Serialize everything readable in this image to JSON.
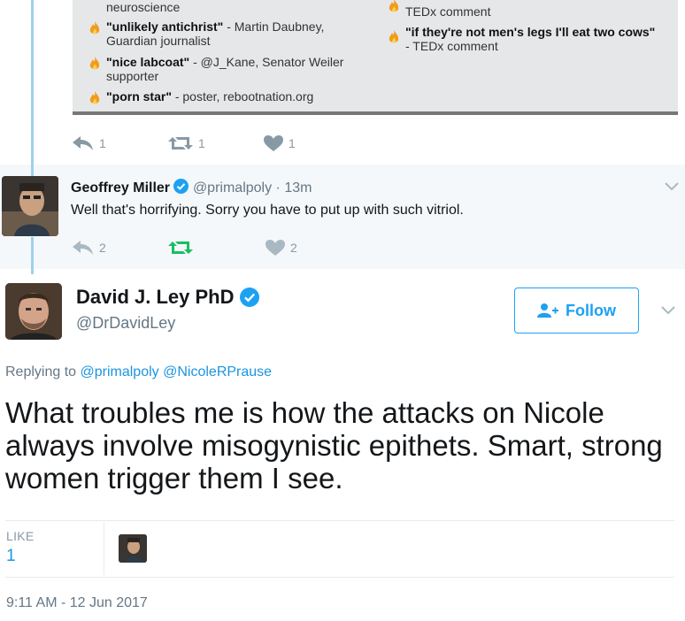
{
  "quoted_card": {
    "left_items": [
      {
        "tail": "neuroscience"
      },
      {
        "quote": "\"unlikely antichrist\"",
        "source": " - Martin Daubney, Guardian journalist"
      },
      {
        "quote": "\"nice labcoat\"",
        "source": " -  @J_Kane, Senator Weiler supporter"
      },
      {
        "quote": "\"porn star\"",
        "source": " - poster, rebootnation.org"
      }
    ],
    "right_items": [
      {
        "source": "TEDx comment"
      },
      {
        "quote": "\"if they're not men's legs I'll eat two cows\"",
        "source": " - TEDx comment"
      }
    ],
    "actions": {
      "replies": "1",
      "retweets": "1",
      "likes": "1"
    }
  },
  "reply_tweet": {
    "name": "Geoffrey Miller",
    "handle": "@primalpoly",
    "time": "· 13m",
    "text": "Well that's horrifying. Sorry you have to put up with such vitriol.",
    "actions": {
      "replies": "2",
      "retweets": "",
      "likes": "2"
    }
  },
  "main_tweet": {
    "name": "David J. Ley PhD",
    "handle": "@DrDavidLey",
    "follow_label": "Follow",
    "replying_prefix": "Replying to",
    "replying_to": [
      "@primalpoly",
      "@NicoleRPrause"
    ],
    "text": "What troubles me is how the attacks on Nicole always involve misogynistic epithets. Smart, strong women trigger them I see.",
    "like_label": "LIKE",
    "like_count": "1",
    "timestamp": "9:11 AM - 12 Jun 2017"
  },
  "colors": {
    "accent": "#1da1f2",
    "link": "#1b95e0",
    "retweet_green": "#17bf63",
    "muted": "#8899a6",
    "reply_bg": "#f5f8fa",
    "thread_line": "#9fd0eb"
  },
  "icons": [
    "flame-icon",
    "reply-icon",
    "retweet-icon",
    "heart-icon",
    "verified-icon",
    "chevron-down-icon",
    "follow-person-icon"
  ]
}
